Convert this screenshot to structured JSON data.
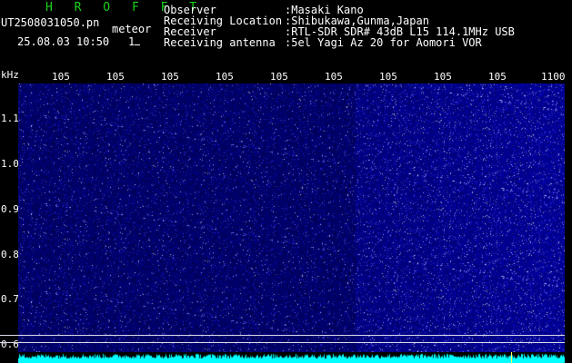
{
  "header": {
    "brand": "H R O F F T",
    "filename": "UT2508031050.pn",
    "meteor": "meteor",
    "datetime": "25.08.03 10:50",
    "count": "1",
    "labels": [
      "Observer",
      "Receiving Location",
      "Receiver",
      "Receiving antenna"
    ],
    "values": [
      ":Masaki Kano",
      ":Shibukawa,Gunma,Japan",
      ":RTL-SDR SDR# 43dB L15 114.1MHz USB",
      ":5el Yagi Az 20 for Aomori VOR"
    ]
  },
  "axis": {
    "y_unit": "kHz",
    "x_ticks": [
      "105",
      "105",
      "105",
      "105",
      "105",
      "105",
      "105",
      "105",
      "105",
      "1100"
    ],
    "y_ticks": [
      "1.1",
      "1.0",
      "0.9",
      "0.8",
      "0.7",
      "0.6"
    ]
  },
  "colors": {
    "background": "#000000",
    "noise_dark": "#0a0a64",
    "noise_mid": "#1a1ab4",
    "noise_bright": "#6a6aff",
    "brand": "#19d219",
    "trace": "#00ffff"
  }
}
